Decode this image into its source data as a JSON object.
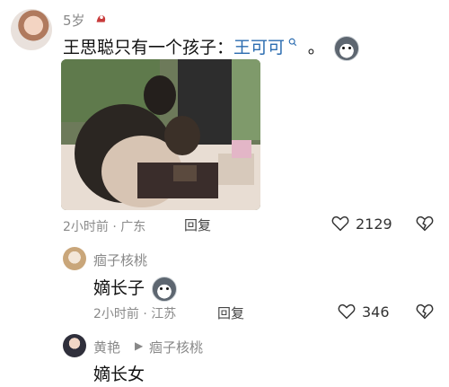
{
  "comment": {
    "username": "5岁",
    "text": "王思聪只有一个孩子：",
    "mention": "王可可",
    "trailing_punct": "。",
    "meta": "2小时前 · 广东",
    "reply_label": "回复",
    "like_count": "2129"
  },
  "replies": [
    {
      "username": "痼子核桃",
      "text": "嫡长子",
      "meta": "2小时前 · 江苏",
      "reply_label": "回复",
      "like_count": "346"
    },
    {
      "username": "黄艳",
      "reply_to": "痼子核桃",
      "text": "嫡长女"
    }
  ],
  "colors": {
    "mention": "#2b6cb0",
    "meta": "#8a8a8a"
  }
}
